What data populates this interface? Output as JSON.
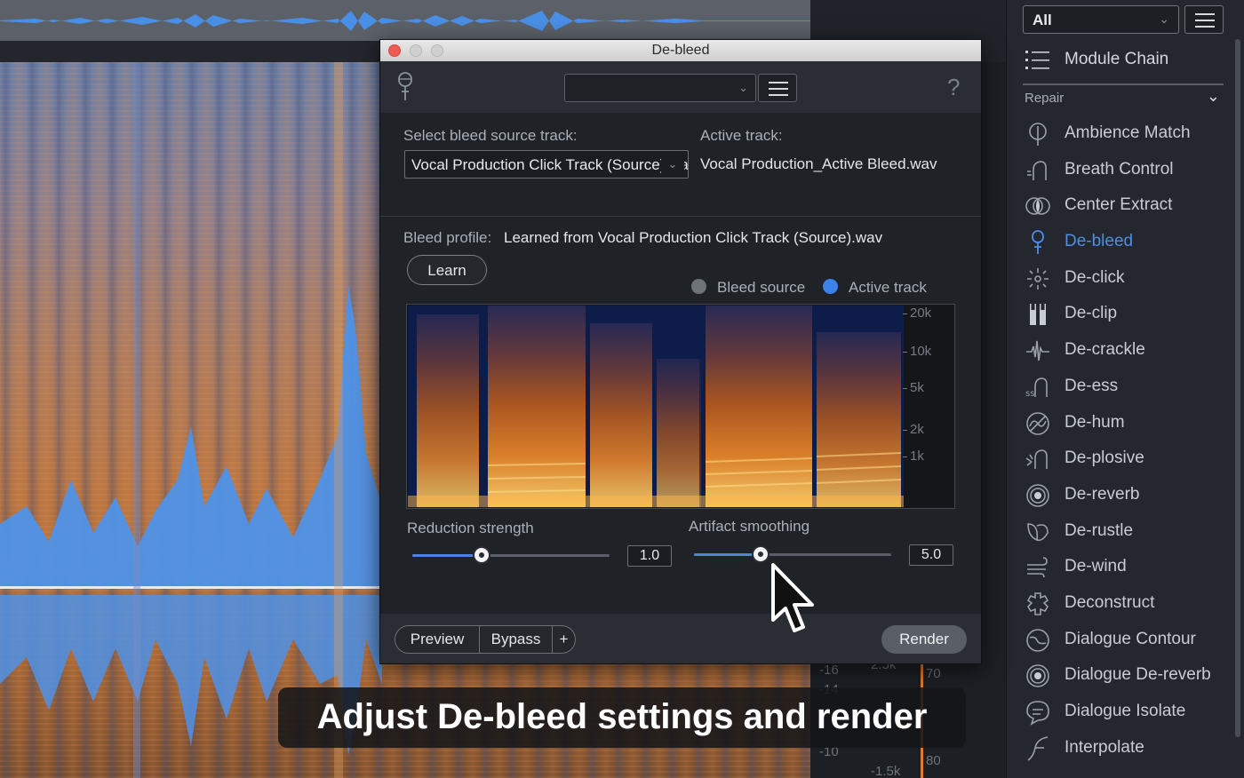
{
  "editor": {
    "scale_labels": [
      "-16",
      "2.5k",
      "70",
      "-14",
      "-10",
      "-1.5k",
      "80"
    ]
  },
  "module_panel": {
    "filter_value": "All",
    "module_chain_label": "Module Chain",
    "section_label": "Repair",
    "items": [
      {
        "label": "Ambience Match",
        "icon": "ambience-match-icon"
      },
      {
        "label": "Breath Control",
        "icon": "breath-control-icon"
      },
      {
        "label": "Center Extract",
        "icon": "center-extract-icon"
      },
      {
        "label": "De-bleed",
        "icon": "de-bleed-icon",
        "active": true
      },
      {
        "label": "De-click",
        "icon": "de-click-icon"
      },
      {
        "label": "De-clip",
        "icon": "de-clip-icon"
      },
      {
        "label": "De-crackle",
        "icon": "de-crackle-icon"
      },
      {
        "label": "De-ess",
        "icon": "de-ess-icon"
      },
      {
        "label": "De-hum",
        "icon": "de-hum-icon"
      },
      {
        "label": "De-plosive",
        "icon": "de-plosive-icon"
      },
      {
        "label": "De-reverb",
        "icon": "de-reverb-icon"
      },
      {
        "label": "De-rustle",
        "icon": "de-rustle-icon"
      },
      {
        "label": "De-wind",
        "icon": "de-wind-icon"
      },
      {
        "label": "Deconstruct",
        "icon": "deconstruct-icon"
      },
      {
        "label": "Dialogue Contour",
        "icon": "dialogue-contour-icon"
      },
      {
        "label": "Dialogue De-reverb",
        "icon": "dialogue-de-reverb-icon"
      },
      {
        "label": "Dialogue Isolate",
        "icon": "dialogue-isolate-icon"
      },
      {
        "label": "Interpolate",
        "icon": "interpolate-icon"
      }
    ],
    "active_color": "#4d8ee8"
  },
  "debleed": {
    "window_title": "De-bleed",
    "preset_value": "",
    "help_label": "?",
    "select_source_label": "Select bleed source track:",
    "source_track_value": "Vocal Production Click Track (Source).wav",
    "active_track_label": "Active track:",
    "active_track_value": "Vocal Production_Active Bleed.wav",
    "bleed_profile_label": "Bleed profile:",
    "bleed_profile_value": "Learned from Vocal Production Click Track (Source).wav",
    "learn_label": "Learn",
    "legend": [
      {
        "label": "Bleed source",
        "color": "#6e737a"
      },
      {
        "label": "Active track",
        "color": "#3d82e8"
      }
    ],
    "freq_labels": [
      "20k",
      "10k",
      "5k",
      "2k",
      "1k"
    ],
    "reduction_label": "Reduction strength",
    "reduction_value": "1.0",
    "reduction_fraction": 0.35,
    "smoothing_label": "Artifact smoothing",
    "smoothing_value": "5.0",
    "smoothing_fraction": 0.34,
    "preview_label": "Preview",
    "bypass_label": "Bypass",
    "plus_label": "+",
    "render_label": "Render",
    "accent_color": "#4a86e0"
  },
  "caption": "Adjust De-bleed settings and render"
}
